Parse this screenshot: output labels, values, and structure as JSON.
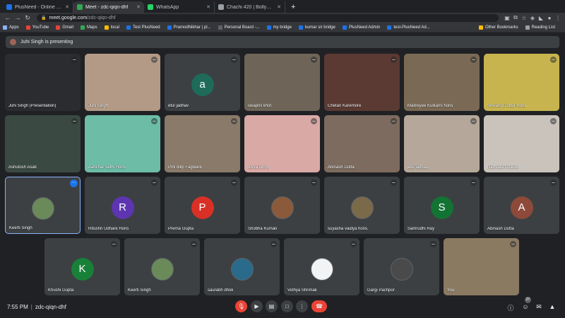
{
  "browser": {
    "tabs": [
      {
        "label": "PlusNeed - Online Tuition with",
        "color": "#1a73e8"
      },
      {
        "label": "Meet - zdc-qiqn-dhf",
        "color": "#34a853",
        "active": true
      },
      {
        "label": "WhatsApp",
        "color": "#25d366"
      },
      {
        "label": "Chachi 420 | Bollywood Dialo...",
        "color": "#9aa0a6"
      }
    ],
    "url_host": "meet.google.com",
    "url_path": "/zdc-qiqn-dhf",
    "bookmarks": [
      {
        "label": "Apps",
        "color": "#8ab4f8"
      },
      {
        "label": "YouTube",
        "color": "#ea4335"
      },
      {
        "label": "Gmail",
        "color": "#ea4335"
      },
      {
        "label": "Maps",
        "color": "#34a853"
      },
      {
        "label": "local",
        "color": "#fbbc04"
      },
      {
        "label": "Test PlusNeed",
        "color": "#1a73e8"
      },
      {
        "label": "PramodNikhar | pl...",
        "color": "#1a73e8"
      },
      {
        "label": "Personal Board -...",
        "color": "#5f6368"
      },
      {
        "label": "my bridge",
        "color": "#1a73e8"
      },
      {
        "label": "kumar sir bridge",
        "color": "#1a73e8"
      },
      {
        "label": "PlusNeed Admin",
        "color": "#1a73e8"
      },
      {
        "label": "test-PlusNeed Ad...",
        "color": "#1a73e8"
      }
    ],
    "other_bookmarks": "Other Bookmarks",
    "reading_list": "Reading List"
  },
  "meet": {
    "presenting_label": "Juhi Singh is presenting",
    "participants": [
      {
        "name": "Juhi Singh (Presentation)",
        "type": "video",
        "bg": "#2b2c30"
      },
      {
        "name": "Juhi Singh",
        "type": "video",
        "bg": "#b29a86"
      },
      {
        "name": "etul jadhav",
        "type": "letter",
        "letter": "a",
        "color": "#1e6b5a"
      },
      {
        "name": "swapnil khot",
        "type": "video",
        "bg": "#6e6558"
      },
      {
        "name": "Chetan Karemore",
        "type": "video",
        "bg": "#5a3a33"
      },
      {
        "name": "Maitreyee Kulkarni hons",
        "type": "video",
        "bg": "#7a6a55"
      },
      {
        "name": "Shivangi Juttur Hons",
        "type": "video",
        "bg": "#c7b44e"
      },
      {
        "name": "Ashutosh Asati",
        "type": "video",
        "bg": "#3a4a42"
      },
      {
        "name": "Aanchal Sethi Hons",
        "type": "video",
        "bg": "#6cbca6"
      },
      {
        "name": "Priti dilip Fagware",
        "type": "video",
        "bg": "#8a7a6a"
      },
      {
        "name": "divya singh",
        "type": "video",
        "bg": "#d8a9a5"
      },
      {
        "name": "Abinash Dutta",
        "type": "video",
        "bg": "#7c6b5e"
      },
      {
        "name": "atul jadhav",
        "type": "video",
        "bg": "#b5a89a"
      },
      {
        "name": "Namrata Chavan",
        "type": "video",
        "bg": "#c9c3bb"
      },
      {
        "name": "Keerti Singh",
        "type": "photo",
        "color": "#6a8a5a",
        "selected": true
      },
      {
        "name": "Ritushri Udhare Hons",
        "type": "letter",
        "letter": "R",
        "color": "#5e35b1"
      },
      {
        "name": "Prerna Gupta",
        "type": "letter",
        "letter": "P",
        "color": "#d93025"
      },
      {
        "name": "Shobha Kumari",
        "type": "photo",
        "color": "#8a5a3a"
      },
      {
        "name": "suyasha vaidya hons.",
        "type": "photo",
        "color": "#7a6a4a"
      },
      {
        "name": "Samrudhi Ray",
        "type": "letter",
        "letter": "S",
        "color": "#137333"
      },
      {
        "name": "Abinash Dutta",
        "type": "letter",
        "letter": "A",
        "color": "#8d4a3a"
      },
      {
        "name": "Khushi Gupta",
        "type": "letter",
        "letter": "K",
        "color": "#188038"
      },
      {
        "name": "Keerti Singh",
        "type": "photo",
        "color": "#6a8a5a"
      },
      {
        "name": "saurabh dhok",
        "type": "photo",
        "color": "#2a6a8a"
      },
      {
        "name": "Vidhya Shrimali",
        "type": "photo",
        "color": "#f1f3f4"
      },
      {
        "name": "Gargi Pachpor",
        "type": "photo",
        "color": "#4a4a4a"
      },
      {
        "name": "You",
        "type": "video",
        "bg": "#8a7a62"
      }
    ],
    "time": "7:55 PM",
    "meeting_code": "zdc-qiqn-dhf",
    "participant_count": "27"
  }
}
